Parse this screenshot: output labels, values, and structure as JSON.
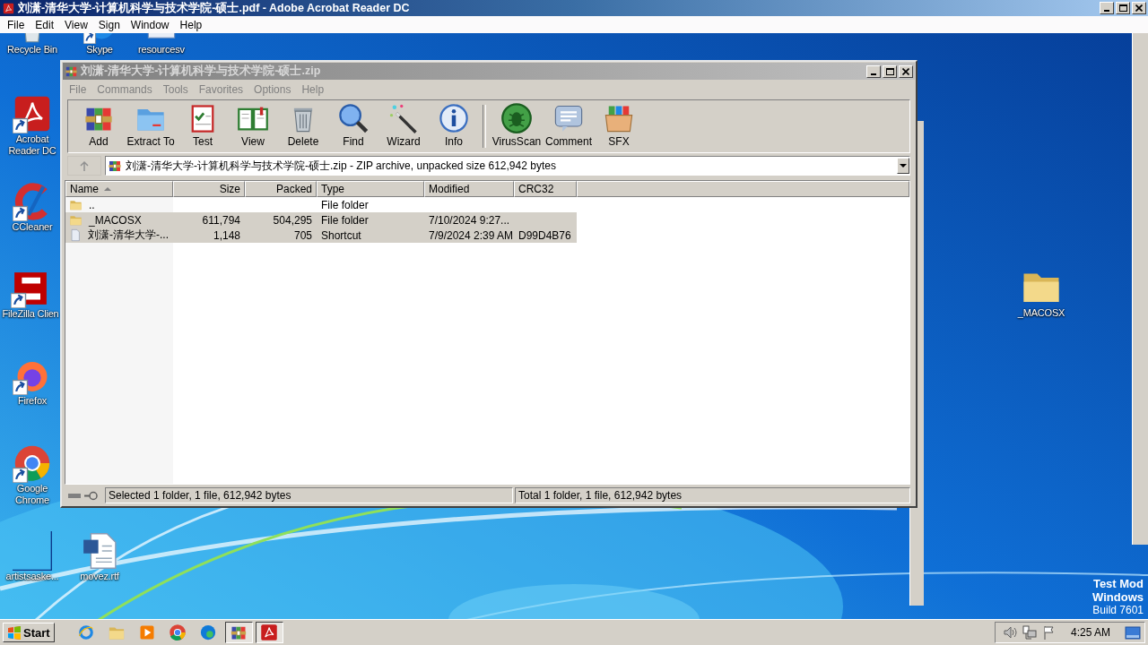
{
  "acrobat": {
    "title": "刘潇-清华大学-计算机科学与技术学院-硕士.pdf - Adobe Acrobat Reader DC",
    "menu": [
      "File",
      "Edit",
      "View",
      "Sign",
      "Window",
      "Help"
    ]
  },
  "desktop_icons": [
    {
      "label": "Recycle Bin",
      "kind": "recycle",
      "shortcut": false
    },
    {
      "label": "Skype",
      "kind": "circle",
      "shortcut": true
    },
    {
      "label": "resourcesv",
      "kind": "document",
      "shortcut": false
    },
    {
      "label": "Acrobat Reader DC",
      "kind": "acrobat",
      "shortcut": true
    },
    {
      "label": "CCleaner",
      "kind": "cleaner",
      "shortcut": true
    },
    {
      "label": "FileZilla Clien",
      "kind": "filezilla",
      "shortcut": true
    },
    {
      "label": "Firefox",
      "kind": "firefox",
      "shortcut": true
    },
    {
      "label": "Google Chrome",
      "kind": "chrome",
      "shortcut": true
    },
    {
      "label": "artistsaske...",
      "kind": "blank",
      "shortcut": false
    },
    {
      "label": "movez.rtf",
      "kind": "word",
      "shortcut": false
    },
    {
      "label": "_MACOSX",
      "kind": "folder",
      "shortcut": false
    }
  ],
  "winrar": {
    "title": "刘潇-清华大学-计算机科学与技术学院-硕士.zip",
    "menu": [
      "File",
      "Commands",
      "Tools",
      "Favorites",
      "Options",
      "Help"
    ],
    "toolbar_groups": [
      [
        {
          "label": "Add",
          "kind": "add"
        },
        {
          "label": "Extract To",
          "kind": "extract"
        },
        {
          "label": "Test",
          "kind": "test"
        },
        {
          "label": "View",
          "kind": "view"
        },
        {
          "label": "Delete",
          "kind": "delete"
        },
        {
          "label": "Find",
          "kind": "find"
        },
        {
          "label": "Wizard",
          "kind": "wizard"
        },
        {
          "label": "Info",
          "kind": "info"
        }
      ],
      [
        {
          "label": "VirusScan",
          "kind": "virus"
        },
        {
          "label": "Comment",
          "kind": "comment"
        },
        {
          "label": "SFX",
          "kind": "sfx"
        }
      ]
    ],
    "address": "刘潇-清华大学-计算机科学与技术学院-硕士.zip - ZIP archive, unpacked size 612,942 bytes",
    "columns": [
      {
        "label": "Name",
        "sorted": true
      },
      {
        "label": "Size",
        "sorted": false
      },
      {
        "label": "Packed",
        "sorted": false
      },
      {
        "label": "Type",
        "sorted": false
      },
      {
        "label": "Modified",
        "sorted": false
      },
      {
        "label": "CRC32",
        "sorted": false
      }
    ],
    "rows": [
      {
        "kind": "folder",
        "selected": false,
        "cells": [
          "..",
          "",
          "",
          "File folder",
          "",
          ""
        ]
      },
      {
        "kind": "folder",
        "selected": true,
        "cells": [
          "_MACOSX",
          "611,794",
          "504,295",
          "File folder",
          "7/10/2024 9:27...",
          ""
        ]
      },
      {
        "kind": "shortcut",
        "selected": true,
        "cells": [
          "刘潇-清华大学-...",
          "1,148",
          "705",
          "Shortcut",
          "7/9/2024 2:39 AM",
          "D99D4B76"
        ]
      }
    ],
    "status_left": "Selected 1 folder, 1 file, 612,942 bytes",
    "status_right": "Total 1 folder, 1 file, 612,942 bytes"
  },
  "os_notice": [
    "Test Mod",
    "Windows",
    "Build 7601"
  ],
  "taskbar": {
    "start": "Start",
    "apps": [
      {
        "kind": "ie",
        "active": false
      },
      {
        "kind": "explorer",
        "active": false
      },
      {
        "kind": "media",
        "active": false
      },
      {
        "kind": "chrome",
        "active": false
      },
      {
        "kind": "edge",
        "active": false
      },
      {
        "kind": "add",
        "active": true
      },
      {
        "kind": "acrobat",
        "active": true
      }
    ],
    "clock": "4:25 AM"
  }
}
